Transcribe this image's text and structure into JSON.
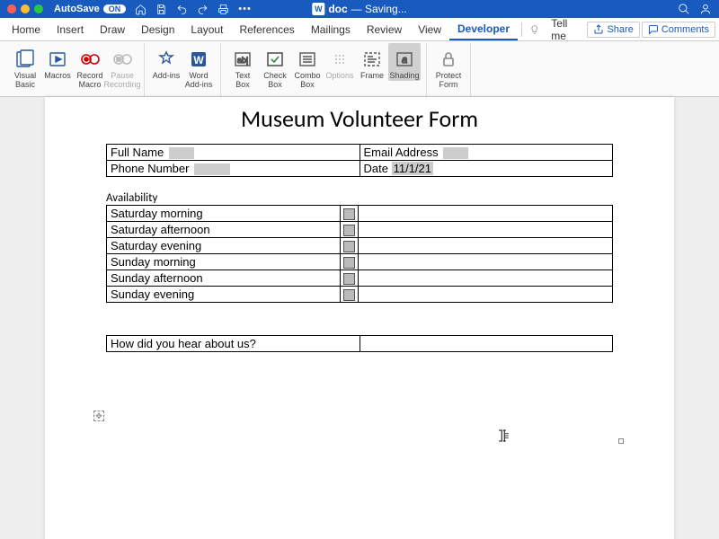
{
  "titlebar": {
    "autosave_label": "AutoSave",
    "autosave_state": "ON",
    "doc_icon": "W",
    "doc_name": "doc",
    "doc_status": "— Saving..."
  },
  "tabs": {
    "items": [
      "Home",
      "Insert",
      "Draw",
      "Design",
      "Layout",
      "References",
      "Mailings",
      "Review",
      "View",
      "Developer"
    ],
    "active_index": 9,
    "tell_me": "Tell me",
    "share": "Share",
    "comments": "Comments"
  },
  "ribbon": {
    "tools": [
      {
        "label_a": "Visual",
        "label_b": "Basic"
      },
      {
        "label_a": "Macros",
        "label_b": ""
      },
      {
        "label_a": "Record",
        "label_b": "Macro"
      },
      {
        "label_a": "Pause",
        "label_b": "Recording",
        "disabled": true
      },
      {
        "label_a": "Add-ins",
        "label_b": ""
      },
      {
        "label_a": "Word",
        "label_b": "Add-ins"
      },
      {
        "label_a": "Text",
        "label_b": "Box"
      },
      {
        "label_a": "Check",
        "label_b": "Box"
      },
      {
        "label_a": "Combo",
        "label_b": "Box"
      },
      {
        "label_a": "Options",
        "label_b": "",
        "disabled": true
      },
      {
        "label_a": "Frame",
        "label_b": ""
      },
      {
        "label_a": "Shading",
        "label_b": "",
        "active": true
      },
      {
        "label_a": "Protect",
        "label_b": "Form"
      }
    ]
  },
  "form": {
    "title": "Museum Volunteer Form",
    "contact": {
      "full_name_label": "Full Name",
      "email_label": "Email Address",
      "phone_label": "Phone Number",
      "date_label": "Date",
      "date_value": "11/1/21"
    },
    "availability_label": "Availability",
    "availability_slots": [
      "Saturday morning",
      "Saturday afternoon",
      "Saturday evening",
      "Sunday morning",
      "Sunday afternoon",
      "Sunday evening"
    ],
    "hear_label": "How did you hear about us?"
  }
}
